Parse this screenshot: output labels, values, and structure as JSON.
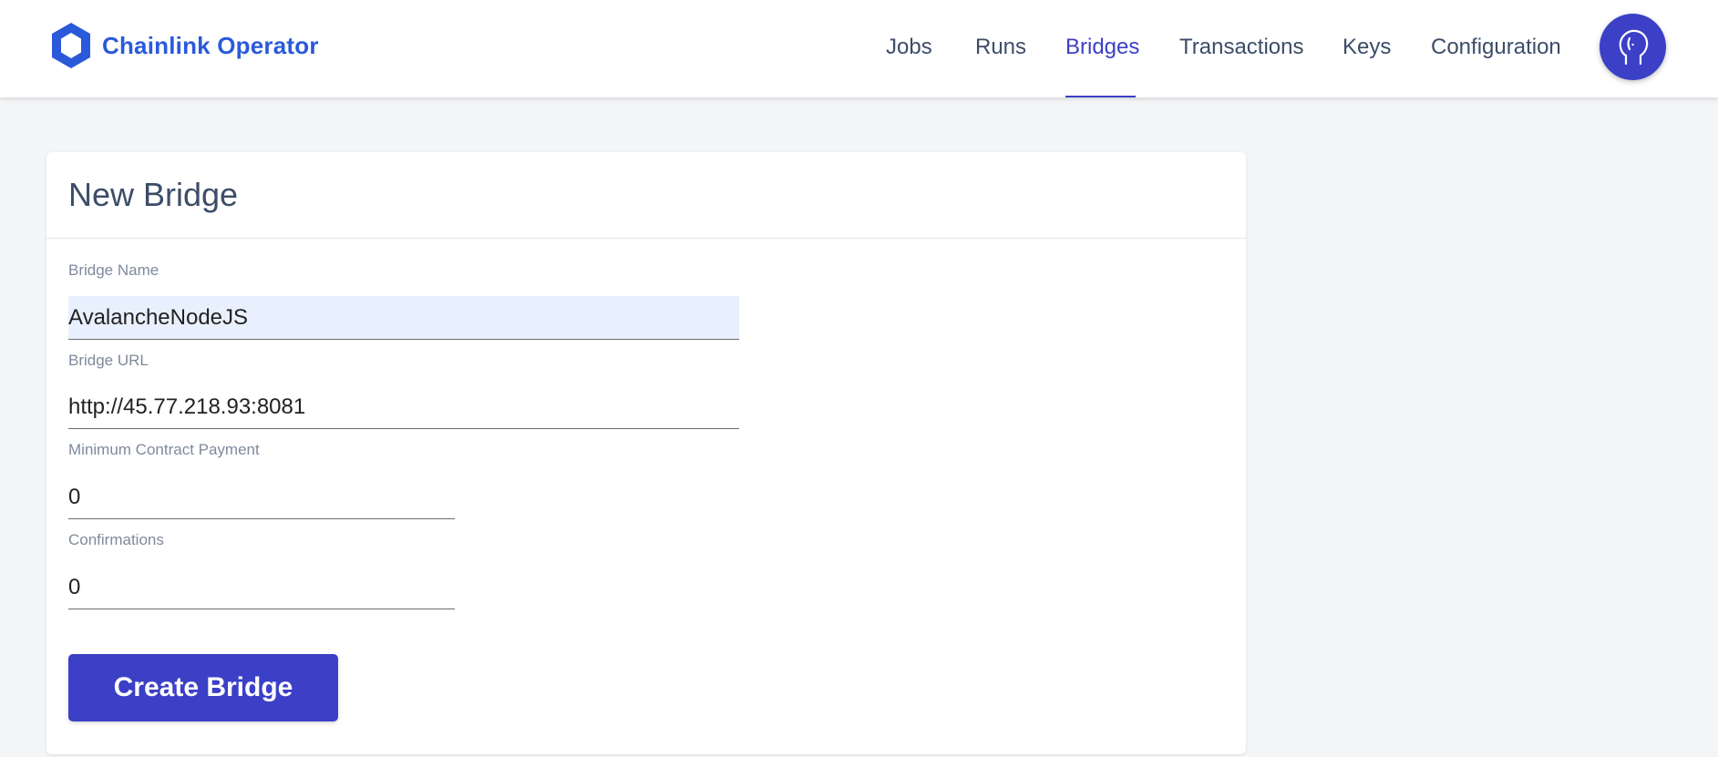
{
  "app": {
    "brand": "Chainlink Operator",
    "brand_color": "#2a5ada",
    "accent_color": "#3c40c6"
  },
  "nav": {
    "items": [
      {
        "label": "Jobs",
        "active": false
      },
      {
        "label": "Runs",
        "active": false
      },
      {
        "label": "Bridges",
        "active": true
      },
      {
        "label": "Transactions",
        "active": false
      },
      {
        "label": "Keys",
        "active": false
      },
      {
        "label": "Configuration",
        "active": false
      }
    ],
    "avatar_icon": "user-head-icon"
  },
  "form": {
    "title": "New Bridge",
    "fields": {
      "name": {
        "label": "Bridge Name",
        "value": "AvalancheNodeJS"
      },
      "url": {
        "label": "Bridge URL",
        "value": "http://45.77.218.93:8081"
      },
      "min_payment": {
        "label": "Minimum Contract Payment",
        "value": "0"
      },
      "confirmations": {
        "label": "Confirmations",
        "value": "0"
      }
    },
    "submit_label": "Create Bridge"
  }
}
